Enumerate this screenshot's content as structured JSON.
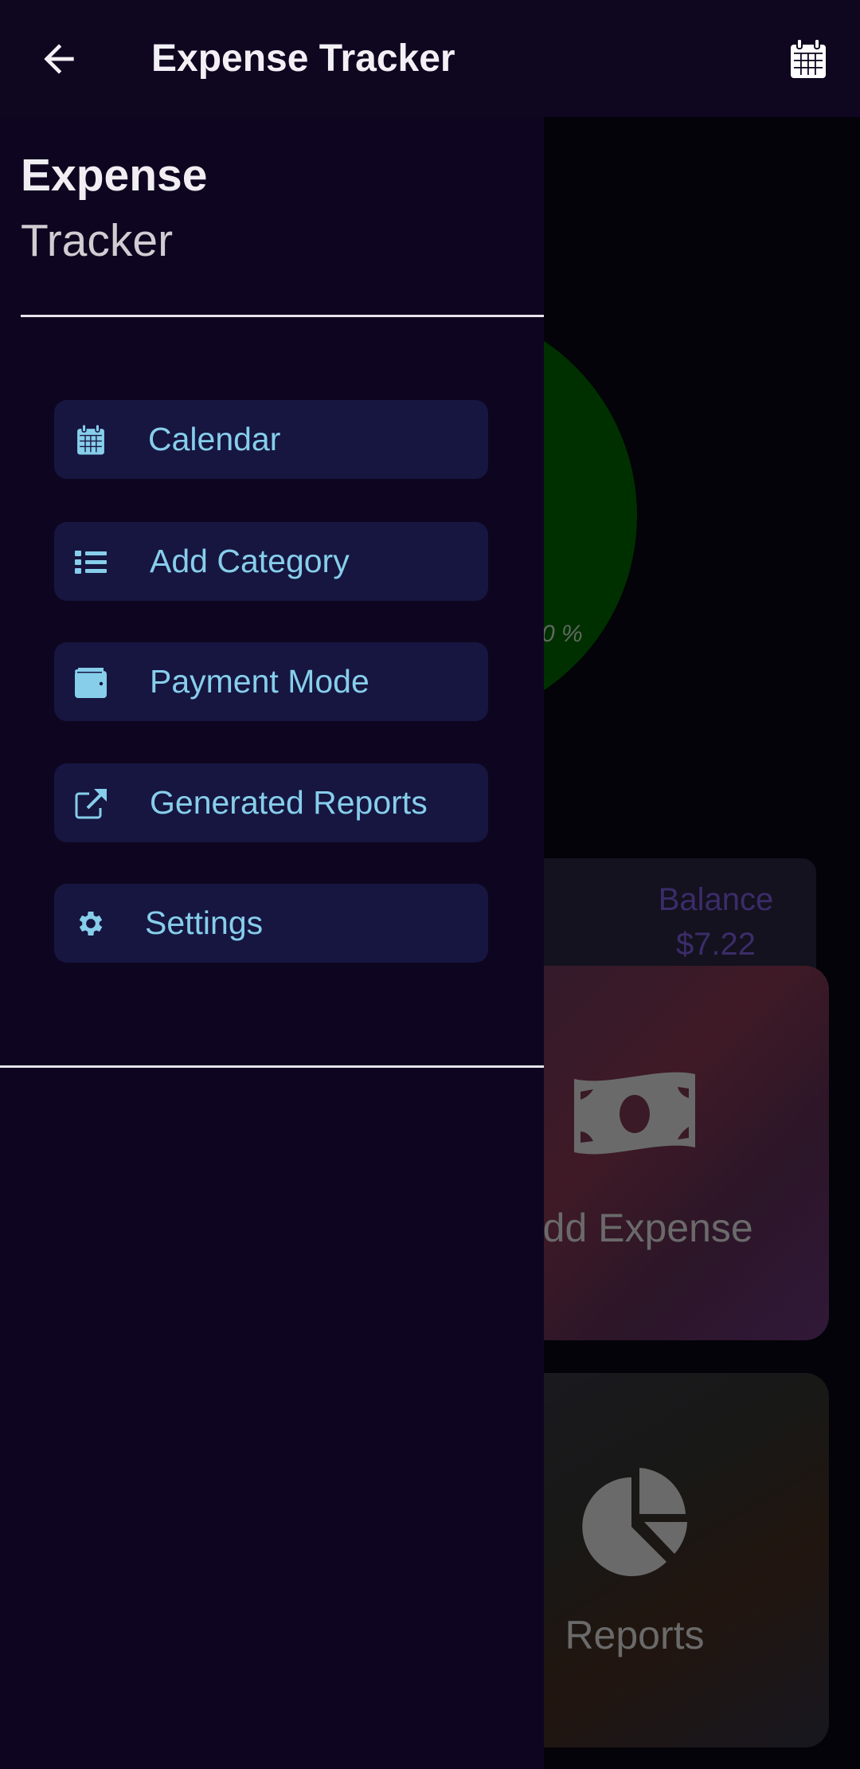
{
  "appbar": {
    "title": "Expense Tracker",
    "back_icon": "arrow-left-icon",
    "action_icon": "calendar-icon"
  },
  "drawer": {
    "title_line1": "Expense",
    "title_line2": "Tracker",
    "items": [
      {
        "label": "Calendar",
        "icon": "calendar-icon"
      },
      {
        "label": "Add Category",
        "icon": "list-icon"
      },
      {
        "label": "Payment Mode",
        "icon": "wallet-icon"
      },
      {
        "label": "Generated Reports",
        "icon": "external-link-icon"
      },
      {
        "label": "Settings",
        "icon": "gear-icon"
      }
    ]
  },
  "background": {
    "pie_percent_label": "0 %",
    "balance_label": "Balance",
    "balance_value": "$7.22",
    "cards": [
      {
        "label": "Add Expense",
        "icon": "money-bill-icon"
      },
      {
        "label": "Reports",
        "icon": "pie-chart-icon"
      }
    ]
  },
  "colors": {
    "accent": "#87ceeb",
    "drawer_bg": "#0e0620",
    "item_bg": "#161640",
    "pie": "#003000",
    "balance_text": "#3c2c6a"
  }
}
